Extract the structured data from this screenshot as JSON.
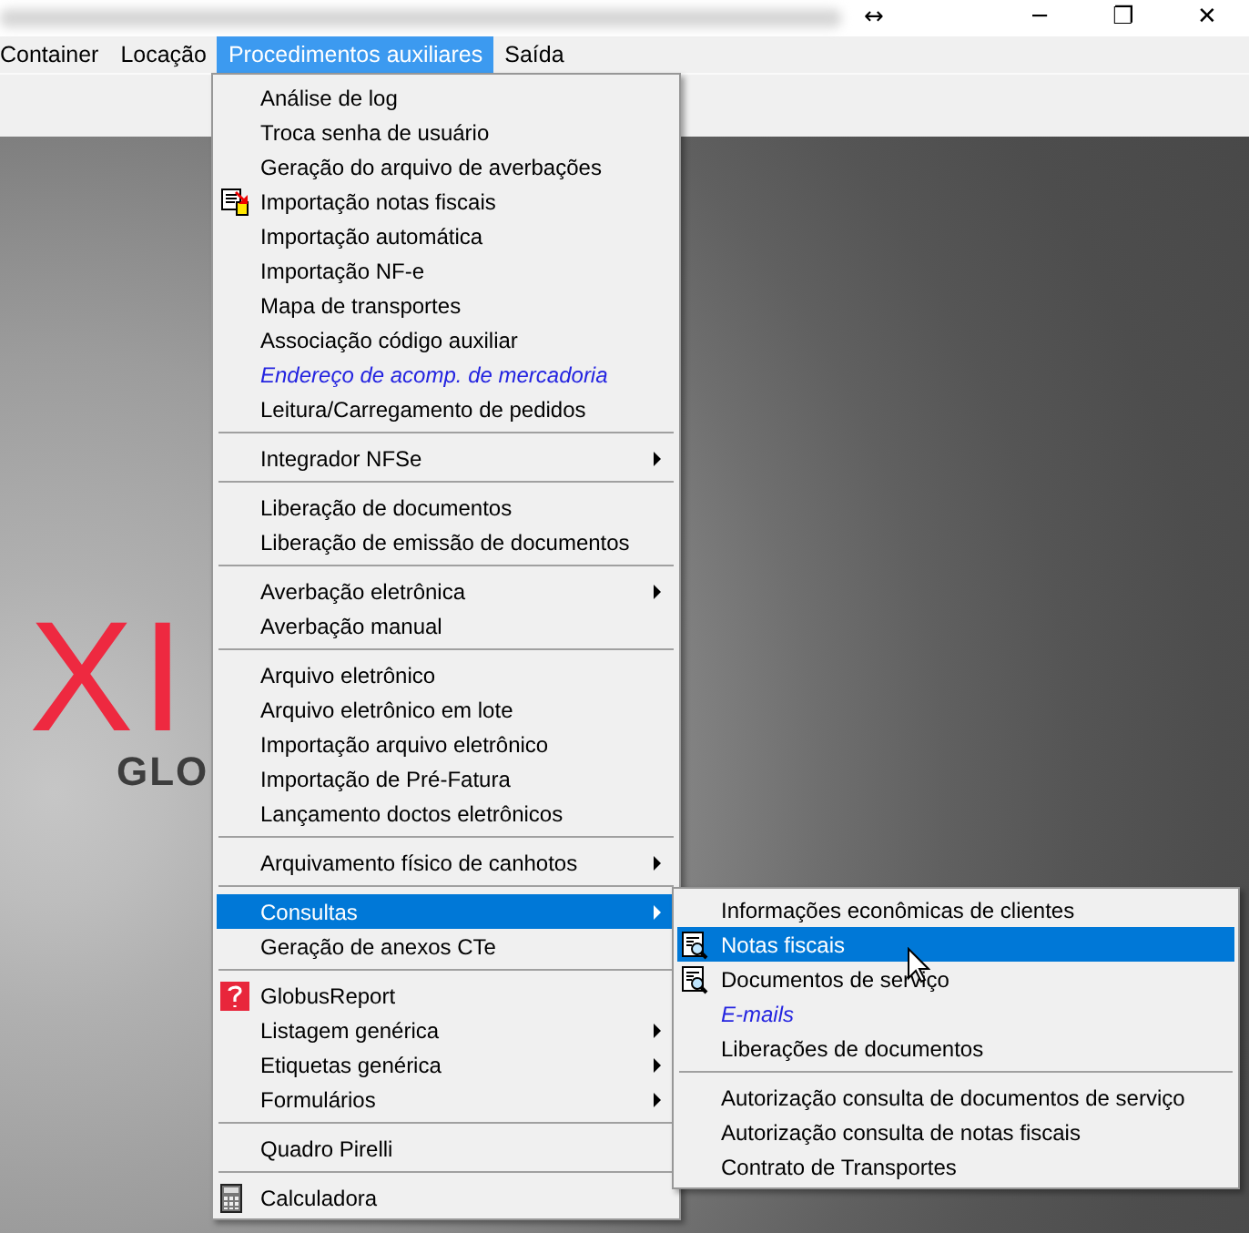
{
  "window": {
    "controls": [
      "↔",
      "─",
      "❐",
      "✕"
    ]
  },
  "menu_bar": [
    {
      "label": "Container",
      "selected": false
    },
    {
      "label": "Locação",
      "selected": false
    },
    {
      "label": "Procedimentos auxiliares",
      "selected": true
    },
    {
      "label": "Saída",
      "selected": false
    }
  ],
  "background": {
    "logo_text": "XI",
    "logo_subtitle": "GLO"
  },
  "dropdown": [
    {
      "kind": "item",
      "label": "Análise de log",
      "selected": false
    },
    {
      "kind": "item",
      "label": "Troca senha de usuário",
      "selected": false
    },
    {
      "kind": "item",
      "label": "Geração do arquivo de averbações",
      "selected": false
    },
    {
      "kind": "import",
      "label": "Importação notas fiscais",
      "selected": false
    },
    {
      "kind": "item",
      "label": "Importação automática",
      "selected": false
    },
    {
      "kind": "item",
      "label": "Importação NF-e",
      "selected": false
    },
    {
      "kind": "item",
      "label": "Mapa de transportes",
      "selected": false
    },
    {
      "kind": "item",
      "label": "Associação código auxiliar",
      "selected": false
    },
    {
      "kind": "link",
      "label": "Endereço de acomp. de mercadoria",
      "selected": false
    },
    {
      "kind": "item",
      "label": "Leitura/Carregamento de pedidos",
      "selected": false
    },
    {
      "kind": "separator"
    },
    {
      "kind": "item",
      "label": "Integrador NFSe",
      "selected": false,
      "submenu": true
    },
    {
      "kind": "separator"
    },
    {
      "kind": "item",
      "label": "Liberação de documentos",
      "selected": false
    },
    {
      "kind": "item",
      "label": "Liberação de emissão de documentos",
      "selected": false
    },
    {
      "kind": "separator"
    },
    {
      "kind": "item",
      "label": "Averbação eletrônica",
      "selected": false,
      "submenu": true
    },
    {
      "kind": "item",
      "label": "Averbação manual",
      "selected": false
    },
    {
      "kind": "separator"
    },
    {
      "kind": "item",
      "label": "Arquivo eletrônico",
      "selected": false
    },
    {
      "kind": "item",
      "label": "Arquivo eletrônico em lote",
      "selected": false
    },
    {
      "kind": "item",
      "label": "Importação arquivo eletrônico",
      "selected": false
    },
    {
      "kind": "item",
      "label": "Importação de Pré-Fatura",
      "selected": false
    },
    {
      "kind": "item",
      "label": "Lançamento doctos eletrônicos",
      "selected": false
    },
    {
      "kind": "separator"
    },
    {
      "kind": "item",
      "label": "Arquivamento físico de canhotos",
      "selected": false,
      "submenu": true
    },
    {
      "kind": "separator"
    },
    {
      "kind": "item",
      "label": "Consultas",
      "selected": true,
      "submenu": true
    },
    {
      "kind": "item",
      "label": "Geração de anexos CTe",
      "selected": false
    },
    {
      "kind": "separator"
    },
    {
      "kind": "report",
      "label": "GlobusReport",
      "selected": false
    },
    {
      "kind": "item",
      "label": "Listagem genérica",
      "selected": false,
      "submenu": true
    },
    {
      "kind": "item",
      "label": "Etiquetas genérica",
      "selected": false,
      "submenu": true
    },
    {
      "kind": "item",
      "label": "Formulários",
      "selected": false,
      "submenu": true
    },
    {
      "kind": "separator"
    },
    {
      "kind": "item",
      "label": "Quadro Pirelli",
      "selected": false
    },
    {
      "kind": "separator"
    },
    {
      "kind": "calculator",
      "label": "Calculadora",
      "selected": false
    }
  ],
  "submenu": [
    {
      "kind": "item",
      "label": "Informações econômicas de clientes",
      "selected": false
    },
    {
      "kind": "search",
      "label": "Notas fiscais",
      "selected": true
    },
    {
      "kind": "search",
      "label": "Documentos de serviço",
      "selected": false
    },
    {
      "kind": "link",
      "label": "E-mails",
      "selected": false
    },
    {
      "kind": "item",
      "label": "Liberações de documentos",
      "selected": false
    },
    {
      "kind": "separator"
    },
    {
      "kind": "item",
      "label": "Autorização consulta de documentos de serviço",
      "selected": false
    },
    {
      "kind": "item",
      "label": "Autorização consulta de notas fiscais",
      "selected": false
    },
    {
      "kind": "item",
      "label": "Contrato de Transportes",
      "selected": false
    }
  ]
}
